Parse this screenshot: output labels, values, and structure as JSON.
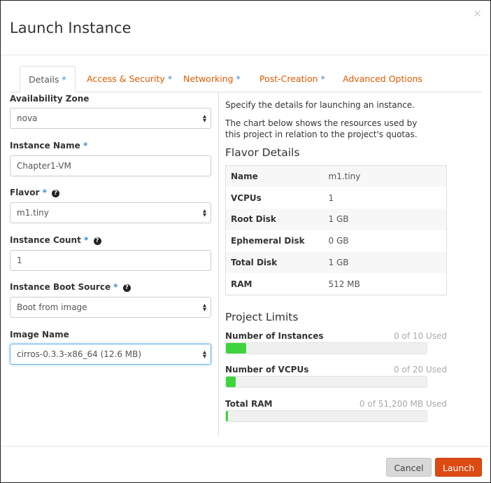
{
  "modal": {
    "title": "Launch Instance",
    "close_icon": "×"
  },
  "tabs": [
    {
      "label": "Details",
      "required": "*",
      "active": true
    },
    {
      "label": "Access & Security",
      "required": "*"
    },
    {
      "label": "Networking",
      "required": "*"
    },
    {
      "label": "Post-Creation",
      "required": "*"
    },
    {
      "label": "Advanced Options"
    }
  ],
  "form": {
    "availability_zone": {
      "label": "Availability Zone",
      "value": "nova"
    },
    "instance_name": {
      "label": "Instance Name",
      "required": "*",
      "value": "Chapter1-VM"
    },
    "flavor": {
      "label": "Flavor",
      "required": "*",
      "help": "?",
      "value": "m1.tiny"
    },
    "instance_count": {
      "label": "Instance Count",
      "required": "*",
      "help": "?",
      "value": "1"
    },
    "boot_source": {
      "label": "Instance Boot Source",
      "required": "*",
      "help": "?",
      "value": "Boot from image"
    },
    "image_name": {
      "label": "Image Name",
      "value": "cirros-0.3.3-x86_64 (12.6 MB)"
    }
  },
  "info": {
    "intro": "Specify the details for launching an instance.",
    "chart_note": "The chart below shows the resources used by this project in relation to the project's quotas."
  },
  "flavor_details": {
    "heading": "Flavor Details",
    "rows": [
      {
        "key": "Name",
        "value": "m1.tiny"
      },
      {
        "key": "VCPUs",
        "value": "1"
      },
      {
        "key": "Root Disk",
        "value": "1 GB"
      },
      {
        "key": "Ephemeral Disk",
        "value": "0 GB"
      },
      {
        "key": "Total Disk",
        "value": "1 GB"
      },
      {
        "key": "RAM",
        "value": "512 MB"
      }
    ]
  },
  "project_limits": {
    "heading": "Project Limits",
    "items": [
      {
        "label": "Number of Instances",
        "used_text": "0 of 10 Used",
        "fill_fraction": 0.1
      },
      {
        "label": "Number of VCPUs",
        "used_text": "0 of 20 Used",
        "fill_fraction": 0.05
      },
      {
        "label": "Total RAM",
        "used_text": "0 of 51,200 MB Used",
        "fill_fraction": 0.01
      }
    ],
    "bar_color": "#3dd43d"
  },
  "footer": {
    "cancel_label": "Cancel",
    "launch_label": "Launch"
  },
  "colors": {
    "accent": "#dd4a14",
    "tab_link": "#e05a00",
    "required_marker": "#3b8bd6"
  }
}
